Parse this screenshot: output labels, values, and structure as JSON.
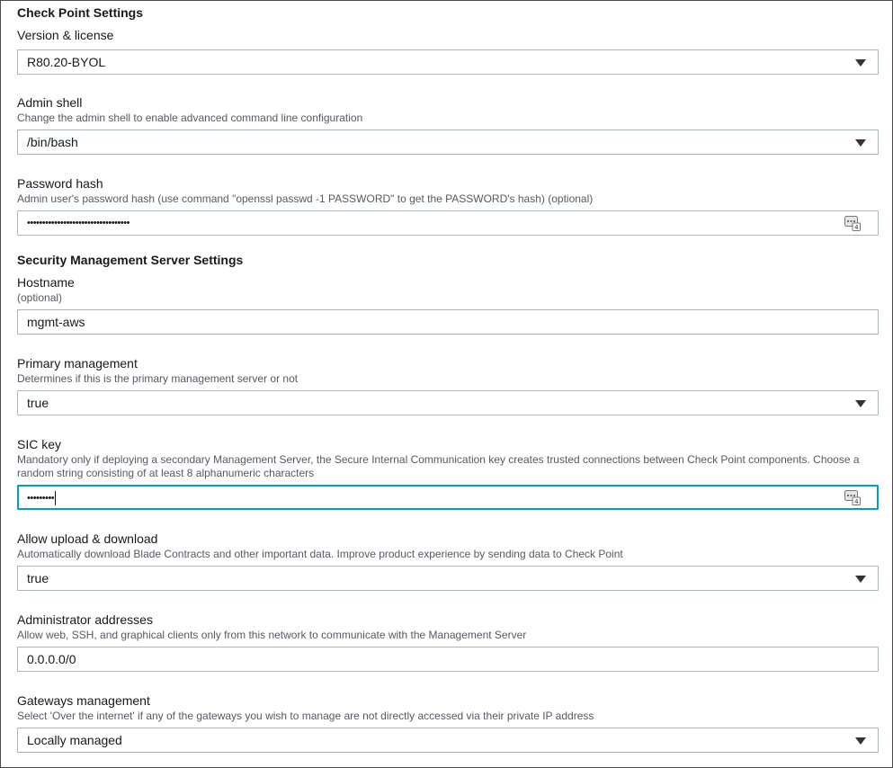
{
  "checkpoint_settings": {
    "title": "Check Point Settings",
    "version": {
      "label": "Version & license",
      "value": "R80.20-BYOL"
    },
    "admin_shell": {
      "label": "Admin shell",
      "description": "Change the admin shell to enable advanced command line configuration",
      "value": "/bin/bash"
    },
    "password_hash": {
      "label": "Password hash",
      "description": "Admin user's password hash (use command \"openssl passwd -1 PASSWORD\" to get the PASSWORD's hash) (optional)",
      "masked_value": "••••••••••••••••••••••••••••••••••",
      "icon": "password-manager-icon"
    }
  },
  "sms_settings": {
    "title": "Security Management Server Settings",
    "hostname": {
      "label": "Hostname",
      "description": "(optional)",
      "value": "mgmt-aws"
    },
    "primary_management": {
      "label": "Primary management",
      "description": "Determines if this is the primary management server or not",
      "value": "true"
    },
    "sic_key": {
      "label": "SIC key",
      "description": "Mandatory only if deploying a secondary Management Server, the Secure Internal Communication key creates trusted connections between Check Point components. Choose a random string consisting of at least 8 alphanumeric characters",
      "masked_value": "•••••••••",
      "icon": "password-manager-icon"
    },
    "allow_upload": {
      "label": "Allow upload & download",
      "description": "Automatically download Blade Contracts and other important data. Improve product experience by sending data to Check Point",
      "value": "true"
    },
    "admin_addresses": {
      "label": "Administrator addresses",
      "description": "Allow web, SSH, and graphical clients only from this network to communicate with the Management Server",
      "value": "0.0.0.0/0"
    },
    "gateways_management": {
      "label": "Gateways management",
      "description": "Select 'Over the internet' if any of the gateways you wish to manage are not directly accessed via their private IP address",
      "value": "Locally managed"
    }
  },
  "colors": {
    "focus_border": "#00a1c9",
    "field_border": "#aab7b8",
    "description_text": "#545b64"
  }
}
